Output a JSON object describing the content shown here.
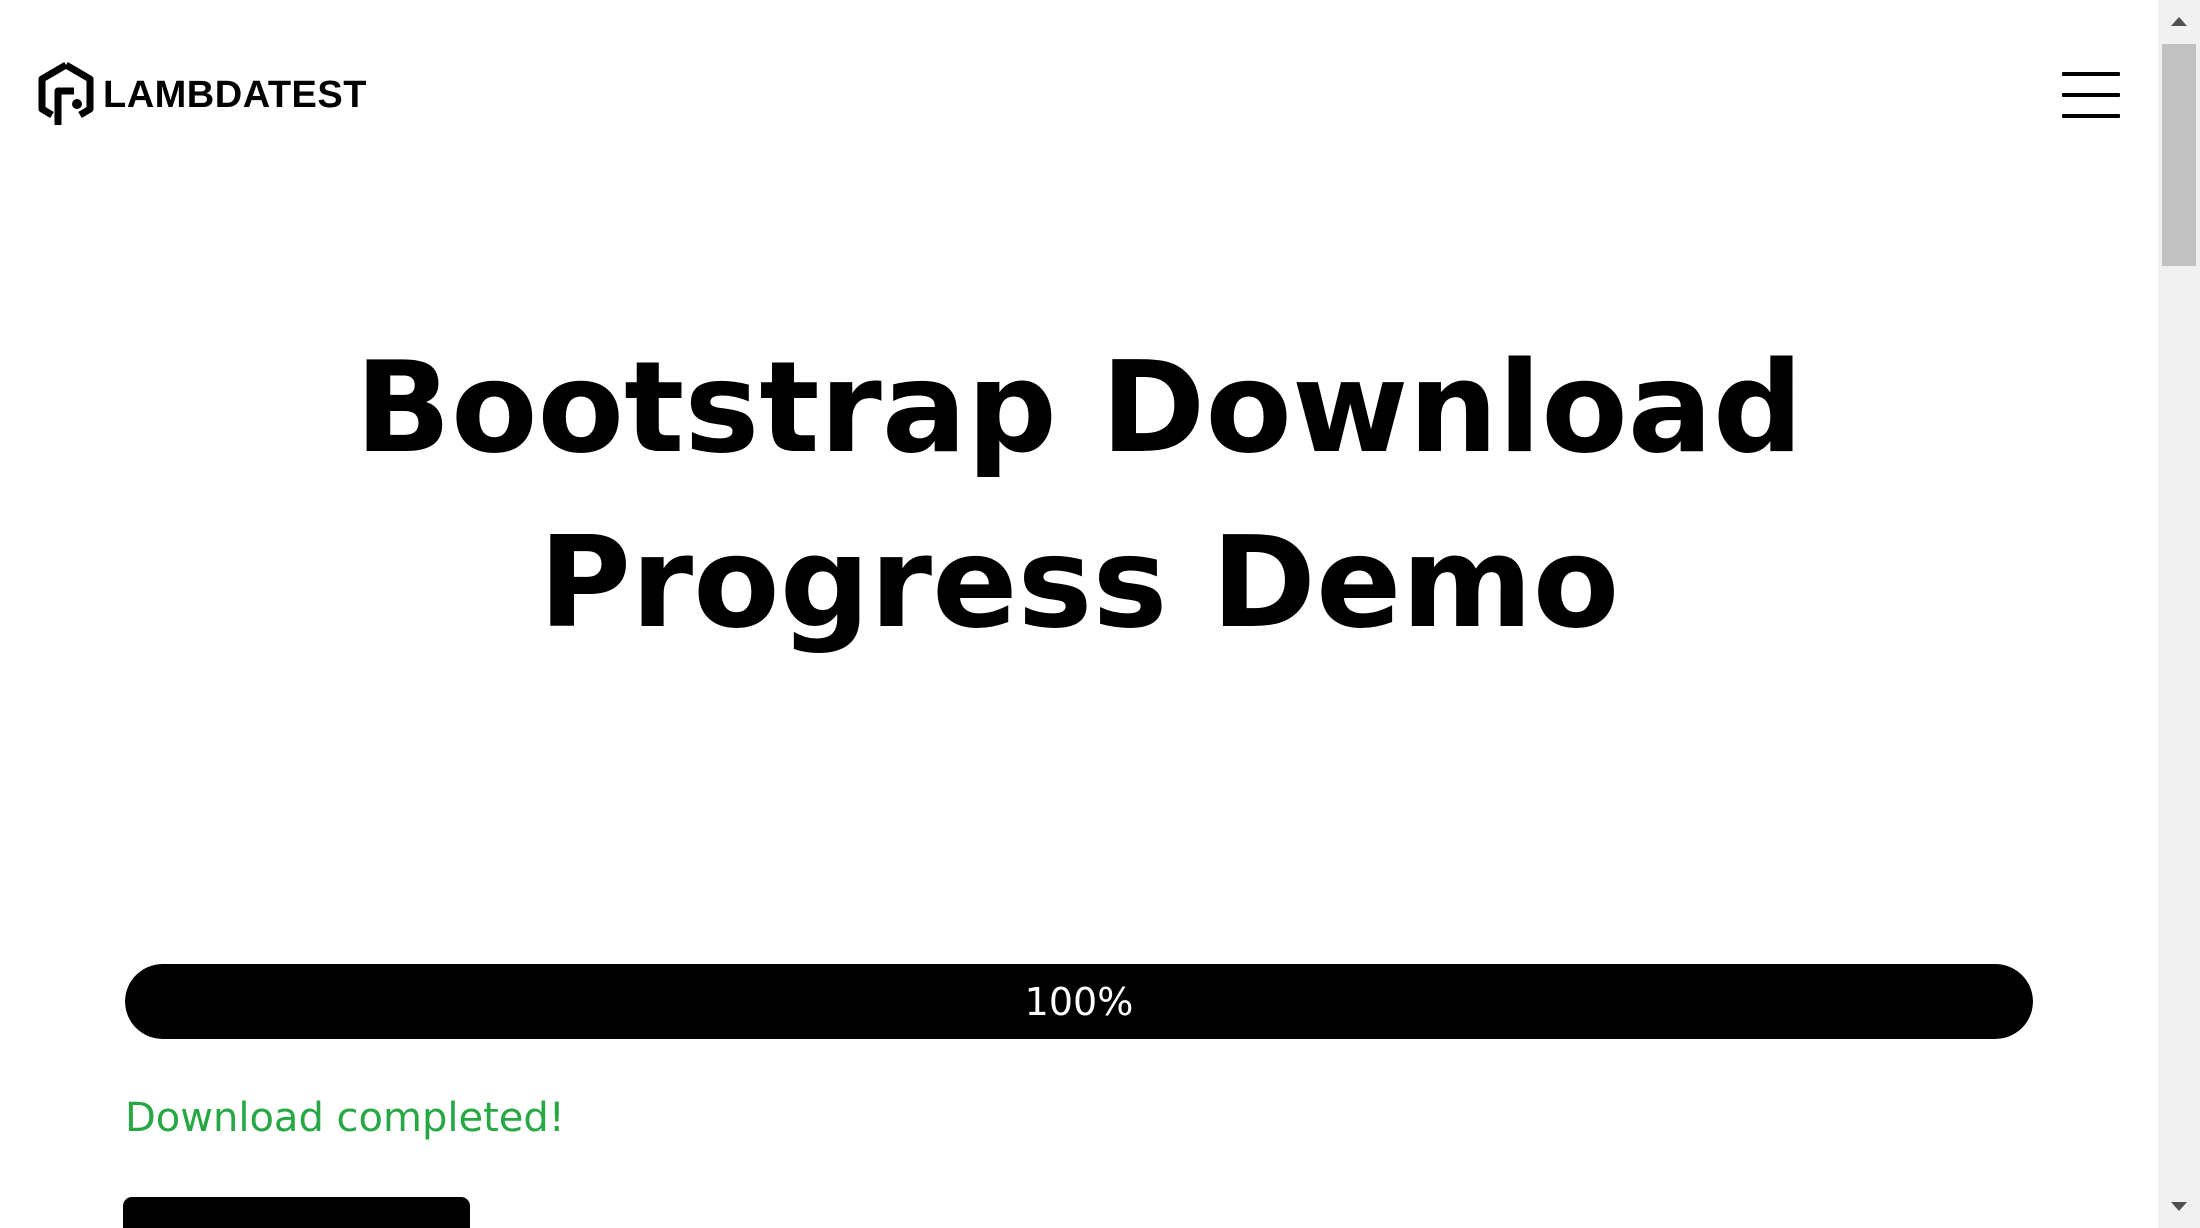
{
  "header": {
    "logo_text": "LAMBDATEST",
    "logo_icon": "lambdatest-logo-icon",
    "menu_icon": "hamburger-menu-icon"
  },
  "main": {
    "title": "Bootstrap Download Progress Demo",
    "progress": {
      "value_percent": 100,
      "label": "100%",
      "fill_color": "#000000"
    },
    "status_message": "Download completed!",
    "status_color": "#28a745"
  },
  "scrollbar": {
    "up_icon": "scroll-up-arrow-icon",
    "down_icon": "scroll-down-arrow-icon"
  }
}
